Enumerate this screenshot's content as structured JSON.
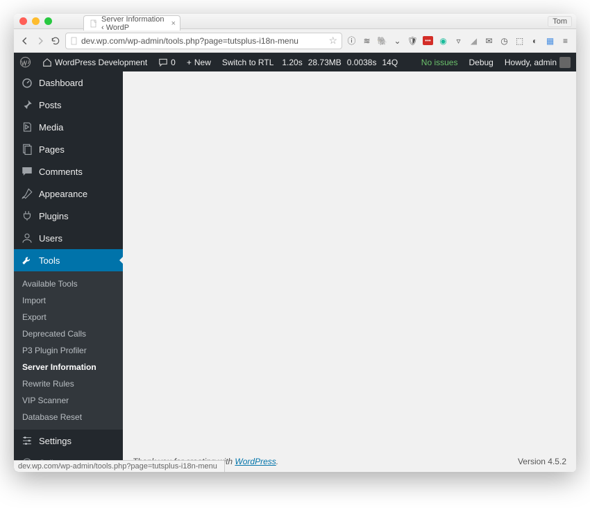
{
  "browser": {
    "tab_title": "Server Information ‹ WordP",
    "url": "dev.wp.com/wp-admin/tools.php?page=tutsplus-i18n-menu",
    "user": "Tom",
    "status_url": "dev.wp.com/wp-admin/tools.php?page=tutsplus-i18n-menu"
  },
  "adminbar": {
    "site": "WordPress Development",
    "comments": "0",
    "new": "New",
    "rtl": "Switch to RTL",
    "time": "1.20s",
    "mem": "28.73MB",
    "db": "0.0038s",
    "q": "14Q",
    "issues": "No issues",
    "debug": "Debug",
    "howdy": "Howdy, admin"
  },
  "menu": {
    "dashboard": "Dashboard",
    "posts": "Posts",
    "media": "Media",
    "pages": "Pages",
    "comments": "Comments",
    "appearance": "Appearance",
    "plugins": "Plugins",
    "users": "Users",
    "tools": "Tools",
    "settings": "Settings",
    "collapse": "Collapse menu"
  },
  "submenu": {
    "available": "Available Tools",
    "import": "Import",
    "export": "Export",
    "deprecated": "Deprecated Calls",
    "p3": "P3 Plugin Profiler",
    "server": "Server Information",
    "rewrite": "Rewrite Rules",
    "vip": "VIP Scanner",
    "dbreset": "Database Reset"
  },
  "footer": {
    "thanks_pre": "Thank you for creating with ",
    "thanks_link": "WordPress",
    "version": "Version 4.5.2"
  }
}
